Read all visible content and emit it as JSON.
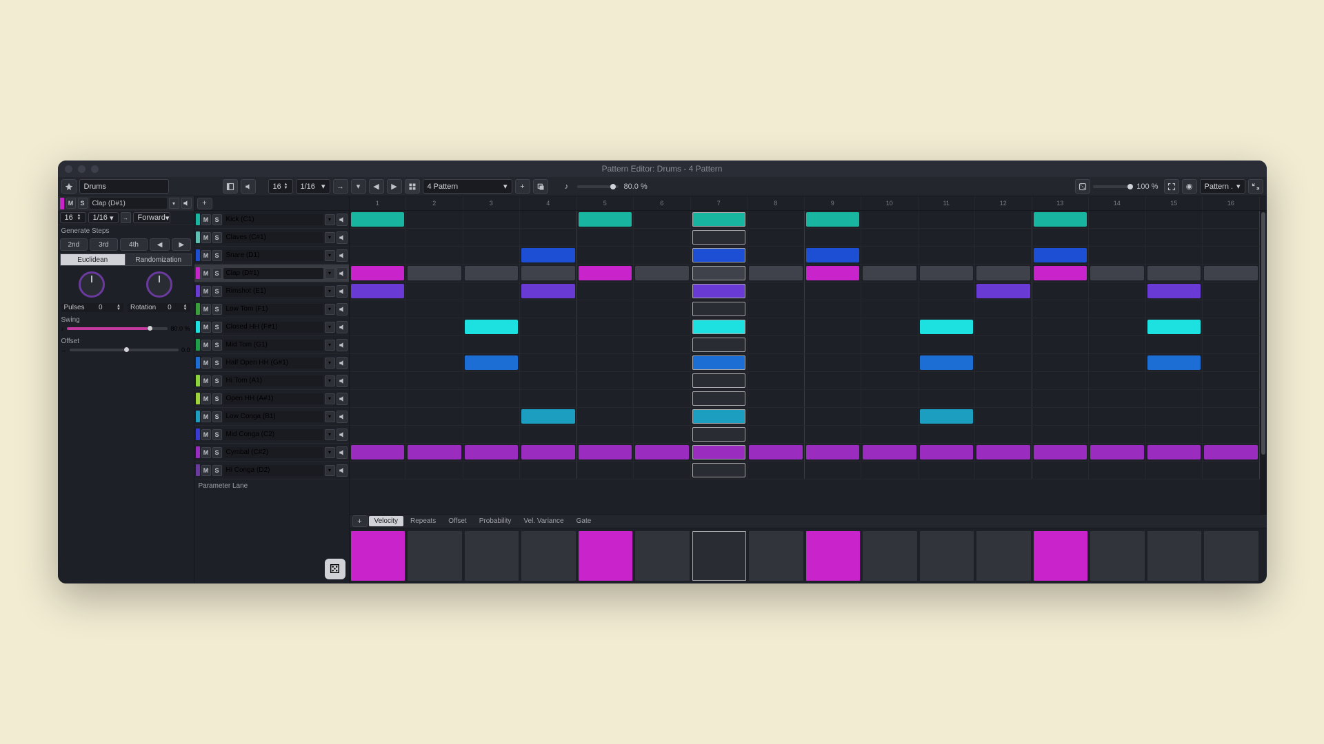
{
  "title": "Pattern Editor: Drums - 4 Pattern",
  "toolbar": {
    "device_name": "Drums",
    "steps": "16",
    "resolution": "1/16",
    "direction": "Forward",
    "pattern_name": "4 Pattern",
    "swing_pct": "80.0 %",
    "zoom_pct": "100 %",
    "menu_label": "Pattern ."
  },
  "sidebar": {
    "selected_track": "Clap (D#1)",
    "steps": "16",
    "resolution": "1/16",
    "direction": "Forward",
    "generate_label": "Generate Steps",
    "gen_buttons": [
      "2nd",
      "3rd",
      "4th"
    ],
    "tabs": [
      "Euclidean",
      "Randomization"
    ],
    "pulses_label": "Pulses",
    "pulses_val": "0",
    "rotation_label": "Rotation",
    "rotation_val": "0",
    "swing_label": "Swing",
    "swing_val": "80.0 %",
    "offset_label": "Offset",
    "offset_val": "0.0"
  },
  "tracks": [
    {
      "name": "Kick (C1)",
      "color": "#18b5a0",
      "sel": false
    },
    {
      "name": "Claves (C#1)",
      "color": "#5dc2b2",
      "sel": false
    },
    {
      "name": "Snare (D1)",
      "color": "#1c4fd4",
      "sel": false
    },
    {
      "name": "Clap (D#1)",
      "color": "#c924cc",
      "sel": true
    },
    {
      "name": "Rimshot (E1)",
      "color": "#6a3ad4",
      "sel": false
    },
    {
      "name": "Low Tom (F1)",
      "color": "#3a9e3a",
      "sel": false
    },
    {
      "name": "Closed HH (F#1)",
      "color": "#1de0e0",
      "sel": false
    },
    {
      "name": "Mid Tom (G1)",
      "color": "#1da048",
      "sel": false
    },
    {
      "name": "Half Open HH (G#1)",
      "color": "#1c6dd4",
      "sel": false
    },
    {
      "name": "Hi Tom (A1)",
      "color": "#8cd43a",
      "sel": false
    },
    {
      "name": "Open HH (A#1)",
      "color": "#9ed43a",
      "sel": false
    },
    {
      "name": "Low Conga (B1)",
      "color": "#1c9ec0",
      "sel": false
    },
    {
      "name": "Mid Conga (C2)",
      "color": "#3a3ad4",
      "sel": false
    },
    {
      "name": "Cymbal (C#2)",
      "color": "#9a2cc0",
      "sel": false
    },
    {
      "name": "Hi Conga (D2)",
      "color": "#6a3a9e",
      "sel": false
    }
  ],
  "param_lane_label": "Parameter Lane",
  "grid": {
    "columns": 16,
    "highlight_col": 7,
    "steps": {
      "0": [
        1,
        5,
        7,
        9,
        13
      ],
      "2": [
        4,
        7,
        9,
        13
      ],
      "3": [
        1,
        2,
        3,
        4,
        5,
        6,
        7,
        8,
        9,
        10,
        11,
        12,
        13,
        14,
        15,
        16
      ],
      "4": [
        1,
        4,
        7,
        12,
        15
      ],
      "6": [
        3,
        7,
        11,
        15
      ],
      "8": [
        3,
        7,
        11,
        15
      ],
      "11": [
        4,
        7,
        11
      ],
      "13": [
        1,
        2,
        3,
        4,
        5,
        6,
        7,
        8,
        9,
        10,
        11,
        12,
        13,
        14,
        15,
        16
      ]
    },
    "hits": {
      "3": [
        1,
        5,
        9,
        13
      ]
    }
  },
  "velocity": {
    "tabs": [
      "Velocity",
      "Repeats",
      "Offset",
      "Probability",
      "Vel. Variance",
      "Gate"
    ],
    "active_tab": 0,
    "bars": [
      100,
      0,
      0,
      0,
      100,
      0,
      0,
      0,
      100,
      0,
      0,
      0,
      100,
      0,
      0,
      0
    ]
  }
}
